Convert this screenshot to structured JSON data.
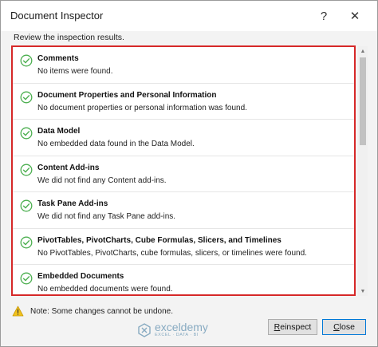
{
  "window": {
    "title": "Document Inspector",
    "help_glyph": "?",
    "close_glyph": "✕"
  },
  "instruction": "Review the inspection results.",
  "results": [
    {
      "title": "Comments",
      "description": "No items were found.",
      "icon": "check-circle-icon"
    },
    {
      "title": "Document Properties and Personal Information",
      "description": "No document properties or personal information was found.",
      "icon": "check-circle-icon"
    },
    {
      "title": "Data Model",
      "description": "No embedded data found in the Data Model.",
      "icon": "check-circle-icon"
    },
    {
      "title": "Content Add-ins",
      "description": "We did not find any Content add-ins.",
      "icon": "check-circle-icon"
    },
    {
      "title": "Task Pane Add-ins",
      "description": "We did not find any Task Pane add-ins.",
      "icon": "check-circle-icon"
    },
    {
      "title": "PivotTables, PivotCharts, Cube Formulas, Slicers, and Timelines",
      "description": "No PivotTables, PivotCharts, cube formulas, slicers, or timelines were found.",
      "icon": "check-circle-icon"
    },
    {
      "title": "Embedded Documents",
      "description": "No embedded documents were found.",
      "icon": "check-circle-icon"
    }
  ],
  "note": "Note: Some changes cannot be undone.",
  "watermark": {
    "name": "exceldemy",
    "tagline": "EXCEL · DATA · BI"
  },
  "buttons": {
    "reinspect": {
      "mnemonic": "R",
      "rest": "einspect"
    },
    "close": {
      "mnemonic": "C",
      "rest": "lose"
    }
  },
  "colors": {
    "check_green": "#4caf50",
    "highlight_red": "#d62828",
    "warning_yellow": "#f2c31d"
  }
}
